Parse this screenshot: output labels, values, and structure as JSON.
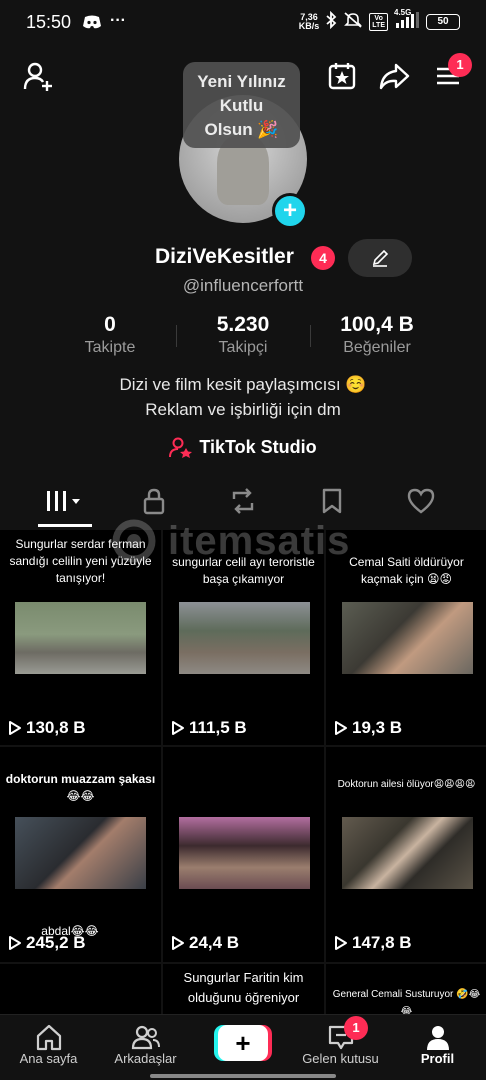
{
  "status_bar": {
    "time": "15:50",
    "ellipsis": "···",
    "speed_value": "7,36",
    "speed_unit": "KB/s",
    "network": "4.5G",
    "volte_top": "Vo",
    "volte_bottom": "LTE",
    "battery": "50"
  },
  "top_nav": {
    "menu_badge": "1"
  },
  "tooltip": {
    "line1": "Yeni Yılınız",
    "line2": "Kutlu",
    "line3": "Olsun 🎉"
  },
  "profile": {
    "username": "DiziVeKesitler",
    "username_badge": "4",
    "handle": "@influencerfortt",
    "stats": [
      {
        "value": "0",
        "label": "Takipte"
      },
      {
        "value": "5.230",
        "label": "Takipçi"
      },
      {
        "value": "100,4 B",
        "label": "Beğeniler"
      }
    ],
    "bio_line1": "Dizi ve film kesit paylaşımcısı ☺️",
    "bio_line2": "Reklam ve işbirliği için dm",
    "studio_label": "TikTok Studio"
  },
  "watermark": {
    "text": "itemsatis"
  },
  "videos": [
    {
      "caption": "Sungurlar serdar ferman sandığı celilin yeni yüzüyle tanışıyor!",
      "views": "130,8 B",
      "overlay": ""
    },
    {
      "caption": "sungurlar celil ayı teroristle başa çıkamıyor",
      "views": "111,5 B",
      "overlay": ""
    },
    {
      "caption": "Cemal Saiti öldürüyor kaçmak için 😫😡",
      "views": "19,3 B",
      "overlay": ""
    },
    {
      "caption": "doktorun muazzam şakası😂😂",
      "views": "245,2 B",
      "overlay": "abdal😂😂"
    },
    {
      "caption": "",
      "views": "24,4 B",
      "overlay": ""
    },
    {
      "caption": "Doktorun ailesi ölüyor😩😩😩😩",
      "views": "147,8 B",
      "overlay": ""
    },
    {
      "caption": "",
      "views": "",
      "overlay": ""
    },
    {
      "caption": "Sungurlar Faritin kim olduğunu öğreniyor",
      "views": "",
      "overlay": ""
    },
    {
      "caption": "General Cemali Susturuyor 🤣😂😂",
      "views": "",
      "overlay": ""
    }
  ],
  "bottom_nav": {
    "home": "Ana sayfa",
    "friends": "Arkadaşlar",
    "inbox": "Gelen kutusu",
    "inbox_badge": "1",
    "profile": "Profil",
    "create_symbol": "+"
  }
}
